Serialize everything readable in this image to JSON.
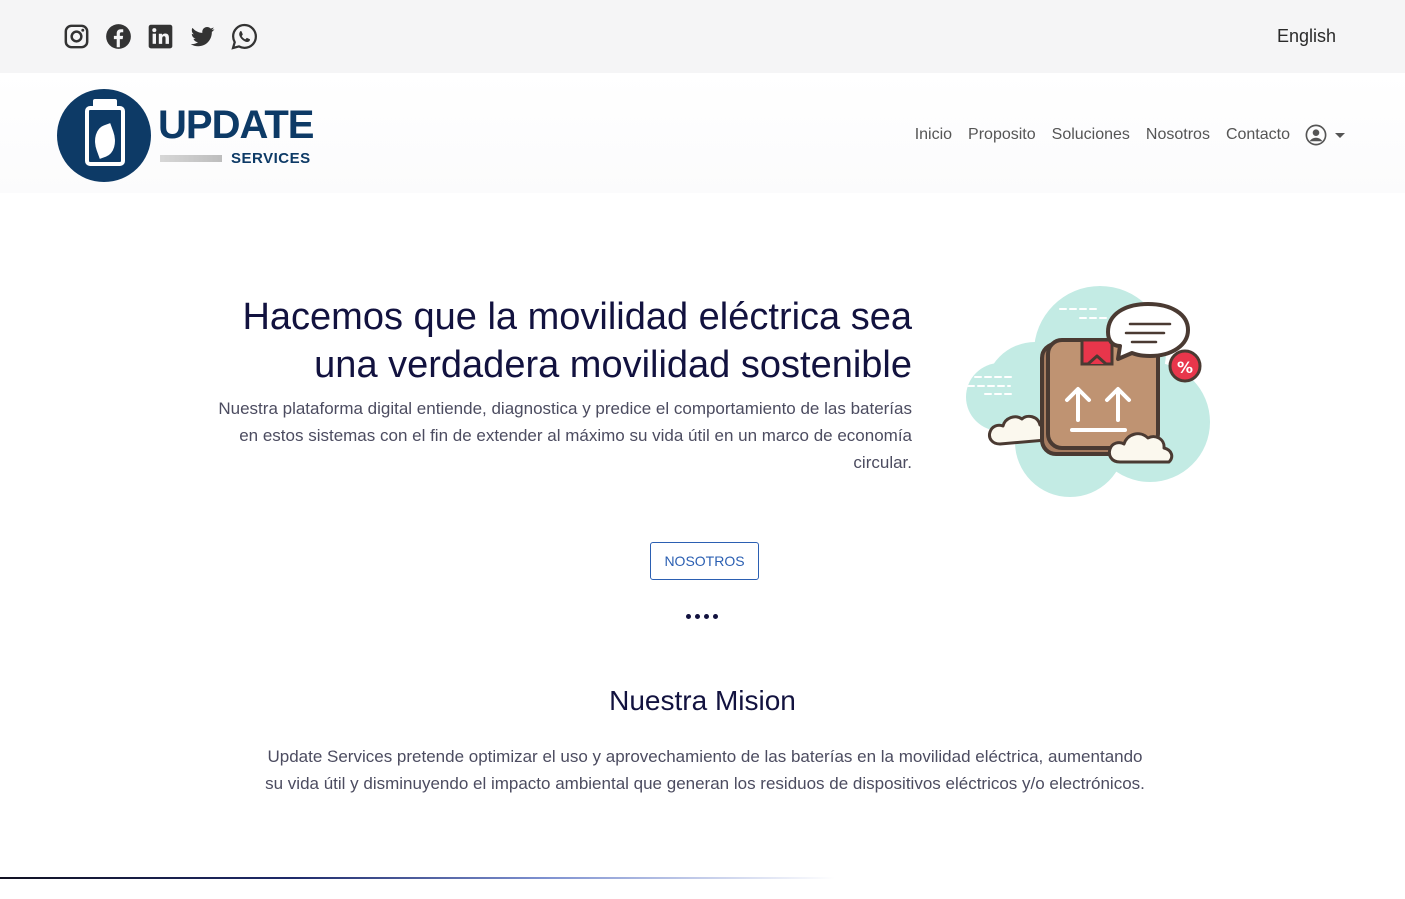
{
  "topbar": {
    "social_icons": [
      "instagram-icon",
      "facebook-icon",
      "linkedin-icon",
      "twitter-icon",
      "whatsapp-icon"
    ],
    "language_link": "English"
  },
  "header": {
    "logo": {
      "word": "UPDATE",
      "sub": "SERVICES"
    },
    "nav": {
      "items": [
        {
          "label": "Inicio"
        },
        {
          "label": "Proposito"
        },
        {
          "label": "Soluciones"
        },
        {
          "label": "Nosotros"
        },
        {
          "label": "Contacto"
        }
      ],
      "user_icon": "user-circle-icon"
    }
  },
  "hero": {
    "title_line1": "Hacemos que la movilidad eléctrica sea",
    "title_line2": "una verdadera movilidad sostenible",
    "description": "Nuestra plataforma digital entiende, diagnostica y predice el comportamiento de las baterías en estos sistemas con el fin de extender al máximo su vida útil en un marco de economía circular.",
    "illustration_badge": "%",
    "cta_label": "NOSOTROS"
  },
  "mision": {
    "title": "Nuestra Mision",
    "text": "Update Services pretende optimizar el uso y aprovechamiento de las baterías en la movilidad eléctrica, aumentando su vida útil y disminuyendo el impacto ambiental que generan los residuos de dispositivos eléctricos y/o electrónicos."
  },
  "colors": {
    "brand_navy": "#0d3a66",
    "heading": "#12123f",
    "button_blue": "#2b5fb2",
    "topbar_bg": "#f5f5f6",
    "illustration_mint": "#bfeae3",
    "box_brown": "#b8896a",
    "badge_red": "#e8364b"
  }
}
